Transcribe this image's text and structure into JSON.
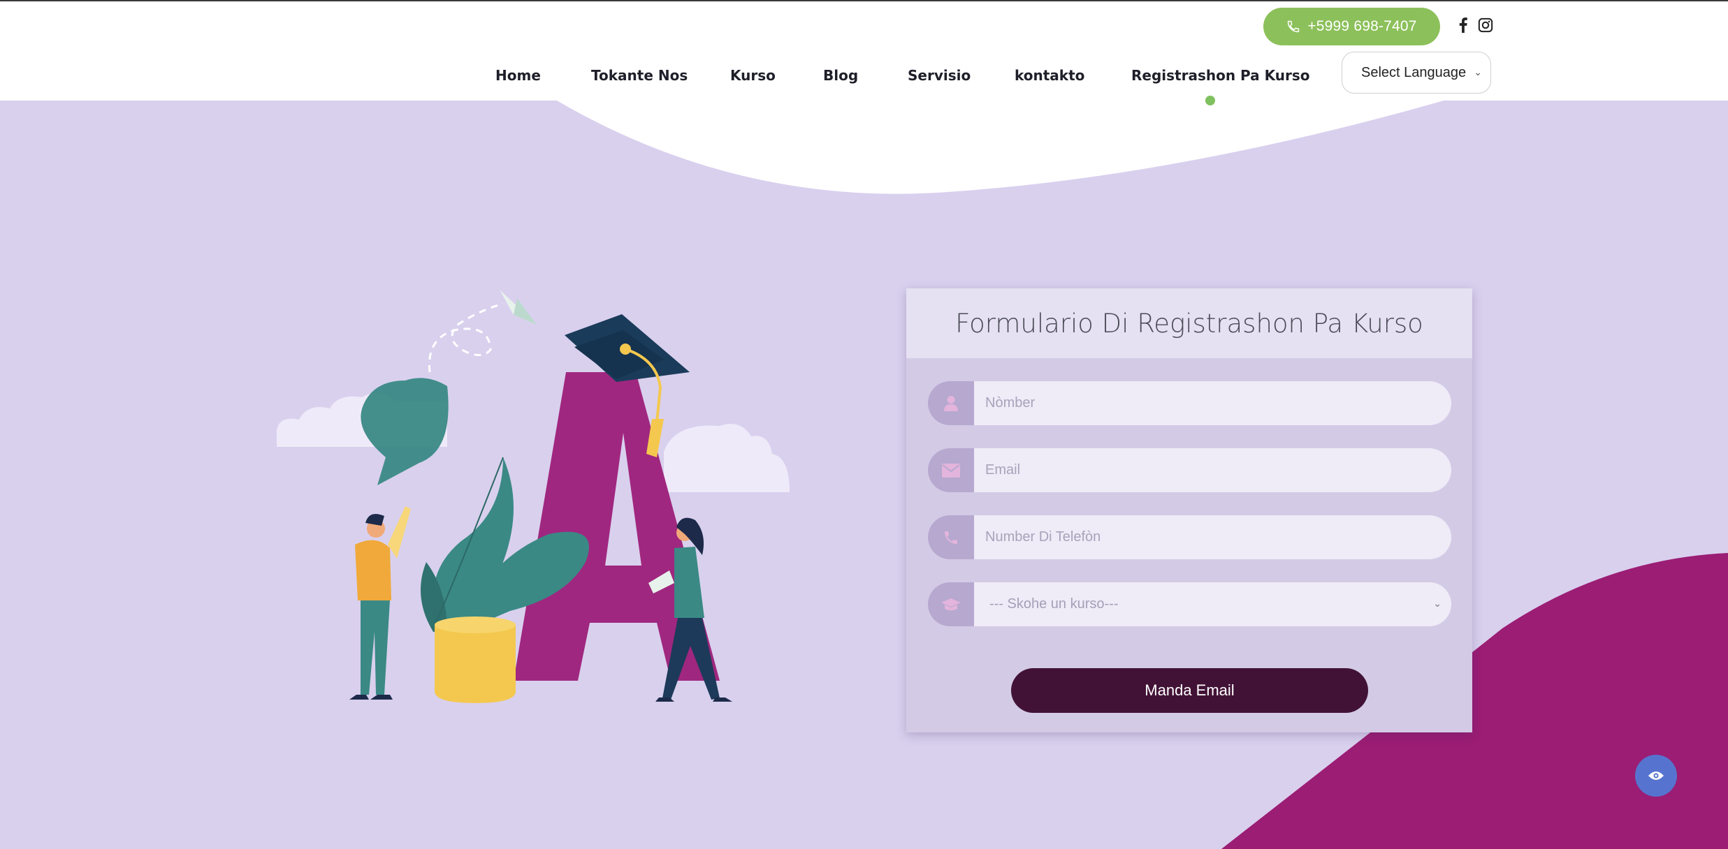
{
  "header": {
    "phone": "+5999 698-7407",
    "social": [
      {
        "icon": "facebook-icon"
      },
      {
        "icon": "instagram-icon"
      }
    ],
    "nav": [
      {
        "label": "Home"
      },
      {
        "label": "Tokante Nos"
      },
      {
        "label": "Kurso"
      },
      {
        "label": "Blog"
      },
      {
        "label": "Servisio"
      },
      {
        "label": "kontakto"
      },
      {
        "label": "Registrashon Pa Kurso",
        "active": true
      }
    ],
    "language_select": "Select Language"
  },
  "form": {
    "title": "Formulario Di Registrashon Pa Kurso",
    "fields": [
      {
        "icon": "user-icon",
        "placeholder": "Nòmber"
      },
      {
        "icon": "envelope-icon",
        "placeholder": "Email"
      },
      {
        "icon": "phone-icon",
        "placeholder": "Number Di Telefòn"
      }
    ],
    "course_select": {
      "icon": "graduation-cap-icon",
      "selected": "--- Skohe un kurso---"
    },
    "submit_label": "Manda Email"
  },
  "accessibility_button": {
    "icon": "eye-icon"
  },
  "colors": {
    "accent_green": "#8cc05a",
    "background_lavender": "#d9d0ee",
    "magenta": "#9b1d74",
    "submit_dark": "#421236",
    "a11y_blue": "#5674cf"
  }
}
